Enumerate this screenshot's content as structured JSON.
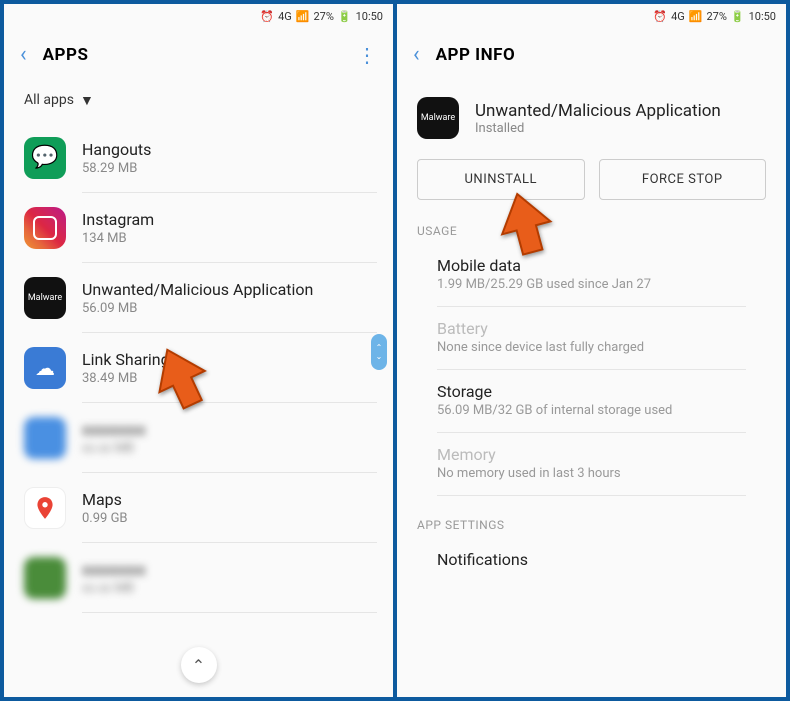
{
  "status": {
    "network": "4G",
    "battery": "27%",
    "time": "10:50"
  },
  "left": {
    "title": "APPS",
    "filter": "All apps",
    "apps": [
      {
        "name": "Hangouts",
        "size": "58.29 MB"
      },
      {
        "name": "Instagram",
        "size": "134 MB"
      },
      {
        "name": "Unwanted/Malicious Application",
        "size": "56.09 MB"
      },
      {
        "name": "Link Sharing",
        "size": "38.49 MB"
      },
      {
        "name": "",
        "size": ""
      },
      {
        "name": "Maps",
        "size": "0.99 GB"
      },
      {
        "name": "",
        "size": ""
      }
    ]
  },
  "right": {
    "title": "APP INFO",
    "app_name": "Unwanted/Malicious Application",
    "app_status": "Installed",
    "icon_text": "Malware",
    "uninstall": "UNINSTALL",
    "force_stop": "FORCE STOP",
    "usage_label": "USAGE",
    "mobile_data": {
      "title": "Mobile data",
      "sub": "1.99 MB/25.29 GB used since Jan 27"
    },
    "battery": {
      "title": "Battery",
      "sub": "None since device last fully charged"
    },
    "storage": {
      "title": "Storage",
      "sub": "56.09 MB/32 GB of internal storage used"
    },
    "memory": {
      "title": "Memory",
      "sub": "No memory used in last 3 hours"
    },
    "settings_label": "APP SETTINGS",
    "notifications": "Notifications"
  }
}
